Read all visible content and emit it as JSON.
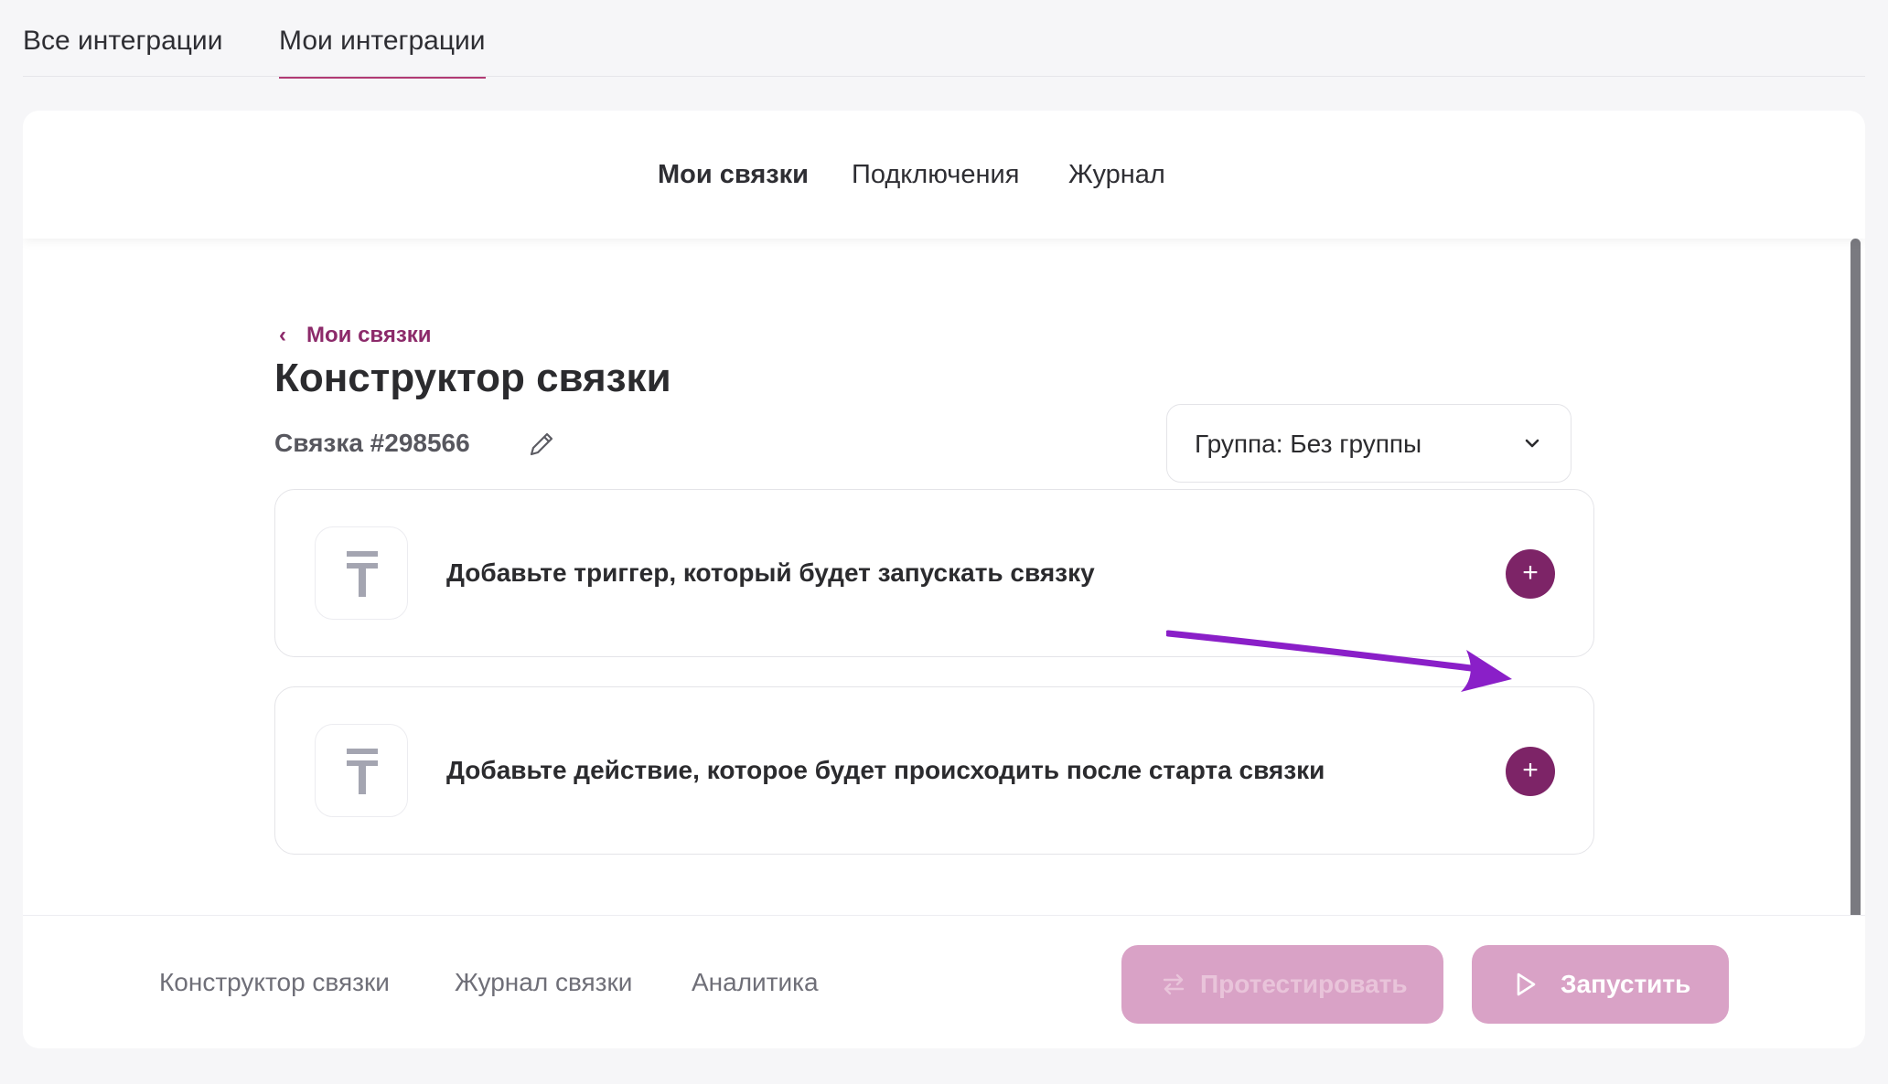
{
  "top_tabs": [
    {
      "label": "Все интеграции"
    },
    {
      "label": "Мои интеграции",
      "active": true
    }
  ],
  "sub_tabs": [
    {
      "label": "Мои связки",
      "active": true
    },
    {
      "label": "Подключения"
    },
    {
      "label": "Журнал"
    }
  ],
  "breadcrumb": {
    "back_label": "Мои связки"
  },
  "page_title": "Конструктор связки",
  "link_id": "Связка #298566",
  "group_select": {
    "value": "Группа: Без группы"
  },
  "steps": [
    {
      "text": "Добавьте триггер, который будет запускать связку",
      "icon": "trigger-icon"
    },
    {
      "text": "Добавьте действие, которое будет происходить после старта связки",
      "icon": "action-icon"
    }
  ],
  "bottom_nav": [
    {
      "label": "Конструктор связки"
    },
    {
      "label": "Журнал связки"
    },
    {
      "label": "Аналитика"
    }
  ],
  "buttons": {
    "test_label": "Протестировать",
    "run_label": "Запустить"
  },
  "colors": {
    "accent": "#7d2467",
    "accent_light": "#d9a2c6",
    "annotation_arrow": "#8a1fc8"
  }
}
